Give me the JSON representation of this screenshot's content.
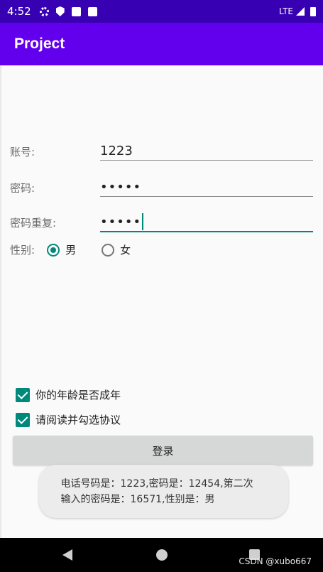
{
  "status_bar": {
    "time": "4:52",
    "network": "LTE",
    "icons": [
      "gear-icon",
      "shield-icon",
      "a-icon",
      "sd-card-icon",
      "signal-icon",
      "battery-icon"
    ]
  },
  "app_bar": {
    "title": "Project"
  },
  "form": {
    "account_label": "账号:",
    "account_value": "1223",
    "password_label": "密码:",
    "password_value": "•••••",
    "password_repeat_label": "密码重复:",
    "password_repeat_value": "•••••",
    "gender_label": "性别:",
    "gender_options": [
      "男",
      "女"
    ],
    "gender_selected": "男"
  },
  "checkboxes": {
    "adult_label": "你的年龄是否成年",
    "agreement_label": "请阅读并勾选协议"
  },
  "login_button": "登录",
  "toast": {
    "line1": "电话号码是：1223,密码是：12454,第二次",
    "line2": "输入的密码是：16571,性别是：男"
  },
  "watermark": "CSDN @xubo667",
  "colors": {
    "status_bar": "#3700b3",
    "app_bar": "#6200ee",
    "accent": "#00897b"
  }
}
